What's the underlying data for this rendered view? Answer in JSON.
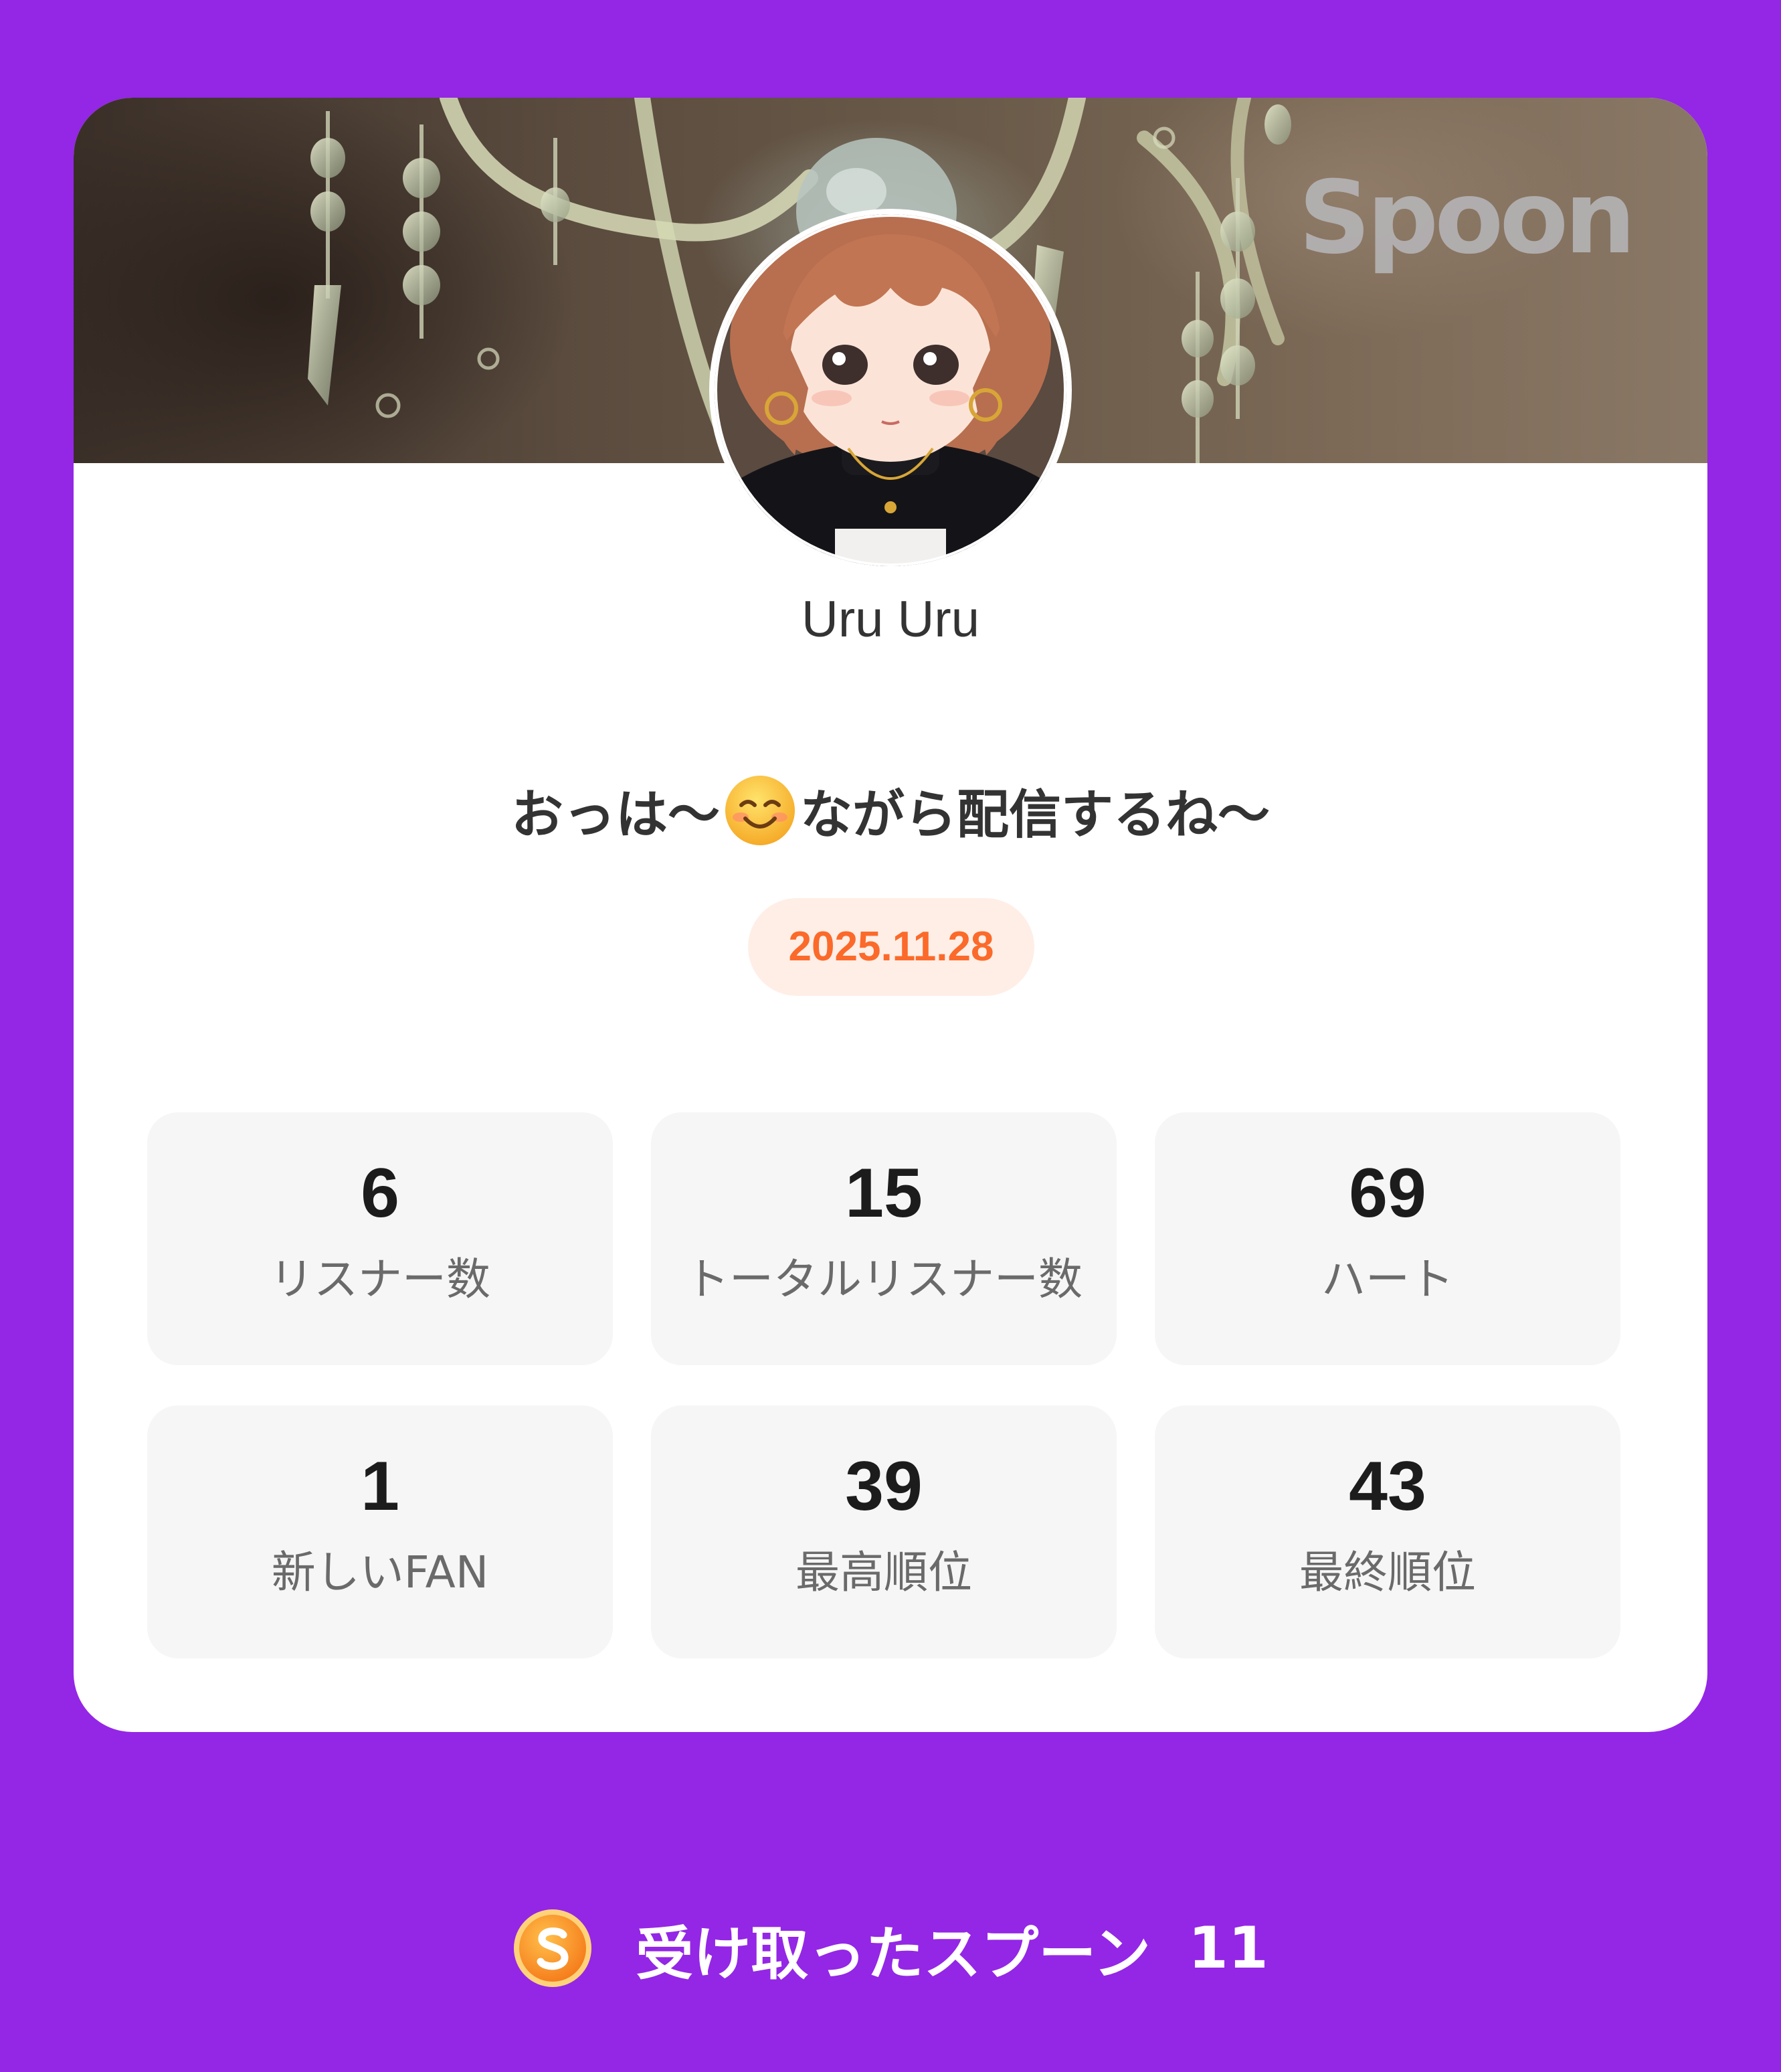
{
  "brand": {
    "logo_text": "Spoon",
    "accent_color": "#9426e6"
  },
  "profile": {
    "name": "Uru Uru"
  },
  "broadcast": {
    "title_before_emoji": "おっは〜",
    "emoji_icon": "smiling-face-emoji",
    "title_after_emoji": "ながら配信するね〜",
    "date": "2025.11.28",
    "date_color": "#fb6a2a"
  },
  "stats": [
    {
      "value": "6",
      "label": "リスナー数"
    },
    {
      "value": "15",
      "label": "トータルリスナー数"
    },
    {
      "value": "69",
      "label": "ハート"
    },
    {
      "value": "1",
      "label": "新しいFAN"
    },
    {
      "value": "39",
      "label": "最高順位"
    },
    {
      "value": "43",
      "label": "最終順位"
    }
  ],
  "footer": {
    "coin_icon": "spoon-coin-icon",
    "label": "受け取ったスプーン",
    "count": "11"
  }
}
